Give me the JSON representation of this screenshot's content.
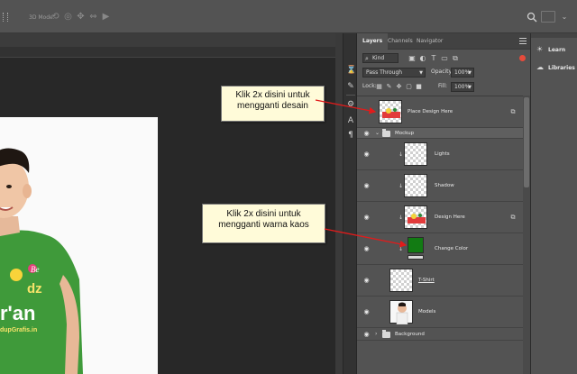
{
  "toolbar": {
    "mode_label": "3D Mode:",
    "icons": [
      "rotate-3d-icon",
      "roll-3d-icon",
      "drag-3d-icon",
      "slide-3d-icon",
      "scale-3d-icon",
      "video-camera-icon"
    ],
    "search_icon": "search-icon",
    "workspace_icon": "workspace-icon"
  },
  "panel": {
    "tabs": [
      "Layers",
      "Channels",
      "Navigator"
    ],
    "active_tab": "Layers",
    "filter": {
      "kind_label": "Kind",
      "icons": [
        "image-filter-icon",
        "adjustment-filter-icon",
        "type-filter-icon",
        "shape-filter-icon",
        "smart-object-filter-icon"
      ]
    },
    "blend_mode": "Pass Through",
    "opacity_label": "Opacity:",
    "opacity_value": "100%",
    "lock_label": "Lock:",
    "lock_icons": [
      "lock-transparent-icon",
      "lock-image-icon",
      "lock-position-icon",
      "lock-artboard-icon",
      "lock-all-icon"
    ],
    "fill_label": "Fill:",
    "fill_value": "100%"
  },
  "layers": [
    {
      "name": "Place Design Here",
      "type": "smart-object",
      "visible": false
    },
    {
      "name": "Mockup",
      "type": "group",
      "visible": true,
      "expanded": true
    },
    {
      "name": "Lights",
      "type": "clipped",
      "visible": true
    },
    {
      "name": "Shadow",
      "type": "clipped",
      "visible": true
    },
    {
      "name": "Design Here",
      "type": "smart-object-clipped",
      "visible": true
    },
    {
      "name": "Change Color",
      "type": "color-fill",
      "visible": true,
      "color": "#127b13"
    },
    {
      "name": "T-Shirt",
      "type": "pixel",
      "visible": true
    },
    {
      "name": "Models",
      "type": "pixel",
      "visible": true
    },
    {
      "name": "Background",
      "type": "group",
      "visible": true,
      "expanded": false
    }
  ],
  "annotations": {
    "design": "Klik 2x disini untuk mengganti desain",
    "color": "Klik 2x disini untuk mengganti warna kaos"
  },
  "right_panel": {
    "items": [
      {
        "label": "Learn",
        "icon": "lightbulb-icon"
      },
      {
        "label": "Libraries",
        "icon": "libraries-cloud-icon"
      }
    ]
  },
  "canvas": {
    "shirt_text": [
      "Be",
      "dz",
      "r'an",
      "dupGrafis.in"
    ],
    "colors": {
      "shirt": "#3f9a3a",
      "annotation_bg": "#fffbd9",
      "arrow": "#e21b1b"
    }
  }
}
